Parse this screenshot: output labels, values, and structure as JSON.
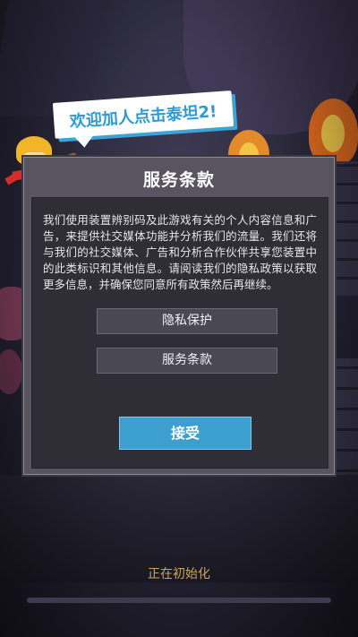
{
  "banner": {
    "text": "欢迎加人点击泰坦2!"
  },
  "dialog": {
    "title": "服务条款",
    "body": "我们使用装置辨别码及此游戏有关的个人内容信息和广告，来提供社交媒体功能并分析我们的流量。我们还将与我们的社交媒体、广告和分析合作伙伴共享您装置中的此类标识和其他信息。请阅读我们的隐私政策以获取更多信息，并确保您同意所有政策然后再继续。",
    "privacy_button": "隐私保护",
    "terms_button": "服务条款",
    "accept_button": "接受"
  },
  "footer": {
    "status": "正在初始化"
  },
  "colors": {
    "accent": "#3c9fd0",
    "banner_text": "#2d9bd3",
    "status_text": "#c6a660"
  }
}
